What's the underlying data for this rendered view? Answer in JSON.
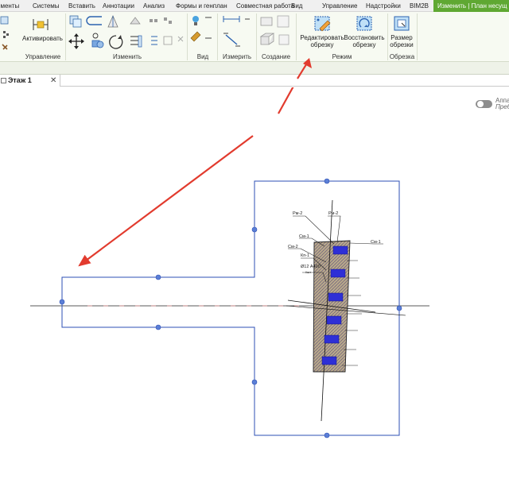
{
  "menu_tabs": [
    {
      "label": "ементы"
    },
    {
      "label": "Системы"
    },
    {
      "label": "Вставить"
    },
    {
      "label": "Аннотации"
    },
    {
      "label": "Анализ"
    },
    {
      "label": "Формы и генплан"
    },
    {
      "label": "Совместная работа"
    },
    {
      "label": "Вид"
    },
    {
      "label": "Управление"
    },
    {
      "label": "Надстройки"
    },
    {
      "label": "BIM2B"
    },
    {
      "label": "Изменить | План несущ"
    }
  ],
  "ribbon": {
    "activate_label": "Активировать",
    "edit_crop_label": "Редактировать обрезку",
    "restore_crop_label": "Восстановить обрезку",
    "crop_size_label": "Размер обрезки",
    "panels": {
      "manage": "Управление",
      "modify": "Изменить",
      "view": "Вид",
      "measure": "Измерить",
      "create": "Создание",
      "mode": "Режим",
      "crop": "Обрезка"
    }
  },
  "view_tab": {
    "label": "Этаж 1",
    "close_glyph": "✕"
  },
  "toggle": {
    "line1": "Аппа",
    "line2": "Преб"
  },
  "drawing": {
    "tags": {
      "rm_left": "Рм-2",
      "rm_right": "Рм-2",
      "sm_left_top": "См-1",
      "sm_left": "См-2",
      "sm_right": "См-1",
      "kn": "Кп-1",
      "rebar": "Ø12 А400",
      "rebar_sub": "l/шт"
    },
    "crop_color": "#2d4fb5",
    "annotation_arrow_color": "#e23b2e"
  }
}
